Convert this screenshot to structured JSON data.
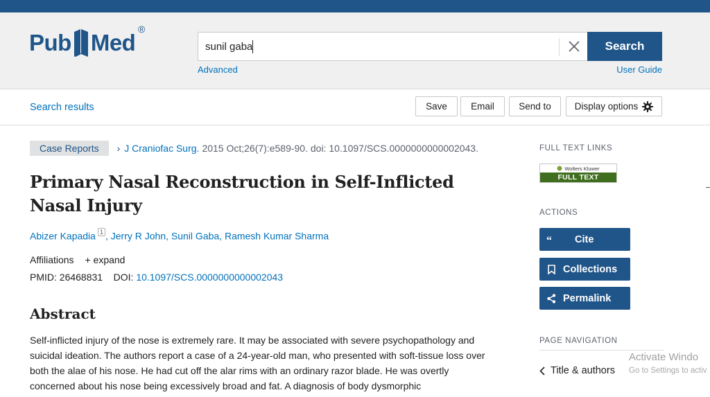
{
  "header": {
    "logo_left": "Pub",
    "logo_right": "Med",
    "logo_reg": "®",
    "search_value": "sunil gaba",
    "search_button": "Search",
    "advanced": "Advanced",
    "user_guide": "User Guide"
  },
  "toolbar": {
    "search_results": "Search results",
    "save": "Save",
    "email": "Email",
    "send_to": "Send to",
    "display_options": "Display options"
  },
  "article": {
    "type": "Case Reports",
    "journal": "J Craniofac Surg.",
    "citation": "2015 Oct;26(7):e589-90. doi: 10.1097/SCS.0000000000002043.",
    "title": "Primary Nasal Reconstruction in Self-Inflicted Nasal Injury",
    "authors": [
      {
        "name": "Abizer Kapadia",
        "sup": "1"
      },
      {
        "name": "Jerry R John"
      },
      {
        "name": "Sunil Gaba"
      },
      {
        "name": "Ramesh Kumar Sharma"
      }
    ],
    "affiliations": "Affiliations",
    "expand": "expand",
    "pmid_label": "PMID:",
    "pmid": "26468831",
    "doi_label": "DOI:",
    "doi": "10.1097/SCS.0000000000002043",
    "abstract_heading": "Abstract",
    "abstract_text": "Self-inflicted injury of the nose is extremely rare. It may be associated with severe psychopathology and suicidal ideation. The authors report a case of a 24-year-old man, who presented with soft-tissue loss over both the alae of his nose. He had cut off the alar rims with an ordinary razor blade. He was overtly concerned about his nose being excessively broad and fat. A diagnosis of body dysmorphic"
  },
  "sidebar": {
    "full_text_links": "FULL TEXT LINKS",
    "wk_brand": "Wolters Kluwer",
    "full_text": "FULL TEXT",
    "actions": "ACTIONS",
    "cite": "Cite",
    "collections": "Collections",
    "permalink": "Permalink",
    "page_navigation": "PAGE NAVIGATION",
    "title_authors": "Title & authors"
  },
  "watermark": {
    "line1": "Activate Windo",
    "line2": "Go to Settings to activ"
  },
  "colors": {
    "brand": "#20558a",
    "link": "#0071bc",
    "fulltext_green": "#3f6e1e"
  }
}
